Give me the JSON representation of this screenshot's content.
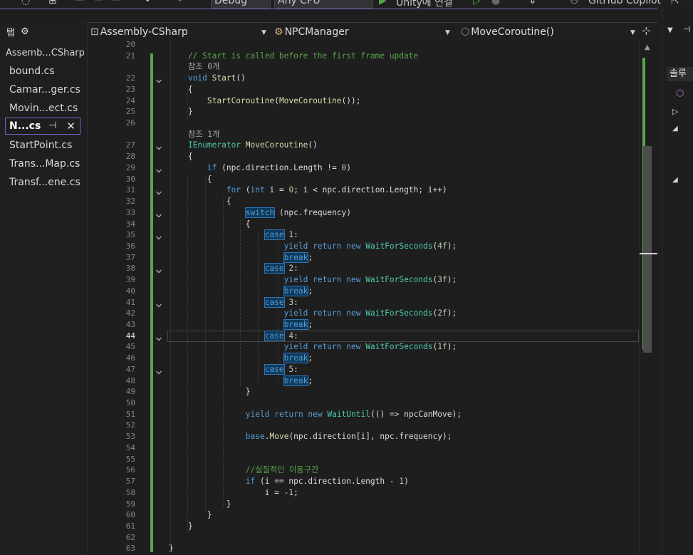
{
  "toolbar": {
    "config": "Debug",
    "platform": "Any CPU",
    "run_label": "Unity에 연결",
    "copilot": "GitHub Copilot"
  },
  "colors": {
    "accent": "#6e66c9",
    "change_bar": "#57a64a",
    "keyword": "#569cd6",
    "comment": "#57a64a",
    "type": "#4ec9b0",
    "method": "#dcdcaa"
  },
  "solution_panel": {
    "header": "탭",
    "group": "Assemb...CSharp",
    "files": [
      "bound.cs",
      "Camar...ger.cs",
      "Movin...ect.cs"
    ],
    "active_file": "N...cs",
    "files_after": [
      "StartPoint.cs",
      "Trans...Map.cs",
      "Transf...ene.cs"
    ]
  },
  "navbar": {
    "project": "Assembly-CSharp",
    "class": "NPCManager",
    "member": "MoveCoroutine()"
  },
  "right_panel": {
    "tab_label": "솔루"
  },
  "editor": {
    "current_line": "44",
    "lines": [
      {
        "n": "20",
        "tokens": []
      },
      {
        "n": "21",
        "tokens": [
          [
            "    // Start is called before the first frame update",
            "cm"
          ]
        ]
      },
      {
        "n": "",
        "tokens": [
          [
            "    참조 0개",
            "lens"
          ]
        ]
      },
      {
        "n": "22",
        "tokens": [
          [
            "    ",
            ""
          ],
          [
            "void",
            "kw"
          ],
          [
            " ",
            ""
          ],
          [
            "Start",
            "fn"
          ],
          [
            "()",
            ""
          ]
        ]
      },
      {
        "n": "23",
        "tokens": [
          [
            "    {",
            ""
          ]
        ]
      },
      {
        "n": "24",
        "tokens": [
          [
            "        ",
            ""
          ],
          [
            "StartCoroutine",
            "fn"
          ],
          [
            "(",
            ""
          ],
          [
            "MoveCoroutine",
            "fn"
          ],
          [
            "());",
            ""
          ]
        ]
      },
      {
        "n": "25",
        "tokens": [
          [
            "    }",
            ""
          ]
        ]
      },
      {
        "n": "26",
        "tokens": []
      },
      {
        "n": "",
        "tokens": [
          [
            "    참조 1개",
            "lens"
          ]
        ]
      },
      {
        "n": "27",
        "tokens": [
          [
            "    ",
            ""
          ],
          [
            "IEnumerator",
            "ty"
          ],
          [
            " ",
            ""
          ],
          [
            "MoveCoroutine",
            "fn"
          ],
          [
            "()",
            ""
          ]
        ]
      },
      {
        "n": "28",
        "tokens": [
          [
            "    {",
            ""
          ]
        ]
      },
      {
        "n": "29",
        "tokens": [
          [
            "        ",
            ""
          ],
          [
            "if",
            "kw"
          ],
          [
            " (npc.direction.Length != ",
            ""
          ],
          [
            "0",
            "nm"
          ],
          [
            ")",
            ""
          ]
        ]
      },
      {
        "n": "30",
        "tokens": [
          [
            "        {",
            ""
          ]
        ]
      },
      {
        "n": "31",
        "tokens": [
          [
            "            ",
            ""
          ],
          [
            "for",
            "kw"
          ],
          [
            " (",
            ""
          ],
          [
            "int",
            "kw"
          ],
          [
            " i = ",
            ""
          ],
          [
            "0",
            "nm"
          ],
          [
            "; i < npc.direction.Length; i++)",
            ""
          ]
        ]
      },
      {
        "n": "32",
        "tokens": [
          [
            "            {",
            ""
          ]
        ]
      },
      {
        "n": "33",
        "tokens": [
          [
            "                ",
            ""
          ],
          [
            "switch",
            "kw hl"
          ],
          [
            " (npc.frequency)",
            ""
          ]
        ]
      },
      {
        "n": "34",
        "tokens": [
          [
            "                {",
            ""
          ]
        ]
      },
      {
        "n": "35",
        "tokens": [
          [
            "                    ",
            ""
          ],
          [
            "case",
            "kw hl"
          ],
          [
            " ",
            ""
          ],
          [
            "1",
            "nm"
          ],
          [
            ":",
            ""
          ]
        ]
      },
      {
        "n": "36",
        "tokens": [
          [
            "                        ",
            ""
          ],
          [
            "yield",
            "kw"
          ],
          [
            " ",
            ""
          ],
          [
            "return",
            "kw"
          ],
          [
            " ",
            ""
          ],
          [
            "new",
            "kw"
          ],
          [
            " ",
            ""
          ],
          [
            "WaitForSeconds",
            "ty"
          ],
          [
            "(",
            ""
          ],
          [
            "4f",
            "nm"
          ],
          [
            ");",
            ""
          ]
        ]
      },
      {
        "n": "37",
        "tokens": [
          [
            "                        ",
            ""
          ],
          [
            "break",
            "kw hl"
          ],
          [
            ";",
            ""
          ]
        ]
      },
      {
        "n": "38",
        "tokens": [
          [
            "                    ",
            ""
          ],
          [
            "case",
            "kw hl"
          ],
          [
            " ",
            ""
          ],
          [
            "2",
            "nm"
          ],
          [
            ":",
            ""
          ]
        ]
      },
      {
        "n": "39",
        "tokens": [
          [
            "                        ",
            ""
          ],
          [
            "yield",
            "kw"
          ],
          [
            " ",
            ""
          ],
          [
            "return",
            "kw"
          ],
          [
            " ",
            ""
          ],
          [
            "new",
            "kw"
          ],
          [
            " ",
            ""
          ],
          [
            "WaitForSeconds",
            "ty"
          ],
          [
            "(",
            ""
          ],
          [
            "3f",
            "nm"
          ],
          [
            ");",
            ""
          ]
        ]
      },
      {
        "n": "40",
        "tokens": [
          [
            "                        ",
            ""
          ],
          [
            "break",
            "kw hl"
          ],
          [
            ";",
            ""
          ]
        ]
      },
      {
        "n": "41",
        "tokens": [
          [
            "                    ",
            ""
          ],
          [
            "case",
            "kw hl"
          ],
          [
            " ",
            ""
          ],
          [
            "3",
            "nm"
          ],
          [
            ":",
            ""
          ]
        ]
      },
      {
        "n": "42",
        "tokens": [
          [
            "                        ",
            ""
          ],
          [
            "yield",
            "kw"
          ],
          [
            " ",
            ""
          ],
          [
            "return",
            "kw"
          ],
          [
            " ",
            ""
          ],
          [
            "new",
            "kw"
          ],
          [
            " ",
            ""
          ],
          [
            "WaitForSeconds",
            "ty"
          ],
          [
            "(",
            ""
          ],
          [
            "2f",
            "nm"
          ],
          [
            ");",
            ""
          ]
        ]
      },
      {
        "n": "43",
        "tokens": [
          [
            "                        ",
            ""
          ],
          [
            "break",
            "kw hl"
          ],
          [
            ";",
            ""
          ]
        ]
      },
      {
        "n": "44",
        "tokens": [
          [
            "                    ",
            ""
          ],
          [
            "case",
            "kw hl"
          ],
          [
            " ",
            ""
          ],
          [
            "4",
            "nm"
          ],
          [
            ":",
            ""
          ]
        ]
      },
      {
        "n": "45",
        "tokens": [
          [
            "                        ",
            ""
          ],
          [
            "yield",
            "kw"
          ],
          [
            " ",
            ""
          ],
          [
            "return",
            "kw"
          ],
          [
            " ",
            ""
          ],
          [
            "new",
            "kw"
          ],
          [
            " ",
            ""
          ],
          [
            "WaitForSeconds",
            "ty"
          ],
          [
            "(",
            ""
          ],
          [
            "1f",
            "nm"
          ],
          [
            ");",
            ""
          ]
        ]
      },
      {
        "n": "46",
        "tokens": [
          [
            "                        ",
            ""
          ],
          [
            "break",
            "kw hl"
          ],
          [
            ";",
            ""
          ]
        ]
      },
      {
        "n": "47",
        "tokens": [
          [
            "                    ",
            ""
          ],
          [
            "case",
            "kw hl"
          ],
          [
            " ",
            ""
          ],
          [
            "5",
            "nm"
          ],
          [
            ":",
            ""
          ]
        ]
      },
      {
        "n": "48",
        "tokens": [
          [
            "                        ",
            ""
          ],
          [
            "break",
            "kw hl"
          ],
          [
            ";",
            ""
          ]
        ]
      },
      {
        "n": "49",
        "tokens": [
          [
            "                }",
            ""
          ]
        ]
      },
      {
        "n": "50",
        "tokens": []
      },
      {
        "n": "51",
        "tokens": [
          [
            "                ",
            ""
          ],
          [
            "yield",
            "kw"
          ],
          [
            " ",
            ""
          ],
          [
            "return",
            "kw"
          ],
          [
            " ",
            ""
          ],
          [
            "new",
            "kw"
          ],
          [
            " ",
            ""
          ],
          [
            "WaitUntil",
            "ty"
          ],
          [
            "(() => npcCanMove);",
            ""
          ]
        ]
      },
      {
        "n": "52",
        "tokens": []
      },
      {
        "n": "53",
        "tokens": [
          [
            "                ",
            ""
          ],
          [
            "base",
            "kw"
          ],
          [
            ".",
            ""
          ],
          [
            "Move",
            "fn"
          ],
          [
            "(npc.direction[i], npc.frequency);",
            ""
          ]
        ]
      },
      {
        "n": "54",
        "tokens": []
      },
      {
        "n": "55",
        "tokens": []
      },
      {
        "n": "56",
        "tokens": [
          [
            "                //실질적인 이동구간",
            "cm"
          ]
        ]
      },
      {
        "n": "57",
        "tokens": [
          [
            "                ",
            ""
          ],
          [
            "if",
            "kw"
          ],
          [
            " (i == npc.direction.Length - ",
            ""
          ],
          [
            "1",
            "nm"
          ],
          [
            ")",
            ""
          ]
        ]
      },
      {
        "n": "58",
        "tokens": [
          [
            "                    i = -",
            ""
          ],
          [
            "1",
            "nm"
          ],
          [
            ";",
            ""
          ]
        ]
      },
      {
        "n": "59",
        "tokens": [
          [
            "            }",
            ""
          ]
        ]
      },
      {
        "n": "60",
        "tokens": [
          [
            "        }",
            ""
          ]
        ]
      },
      {
        "n": "61",
        "tokens": [
          [
            "    }",
            ""
          ]
        ]
      },
      {
        "n": "62",
        "tokens": []
      },
      {
        "n": "63",
        "tokens": [
          [
            "}",
            ""
          ]
        ]
      }
    ]
  }
}
